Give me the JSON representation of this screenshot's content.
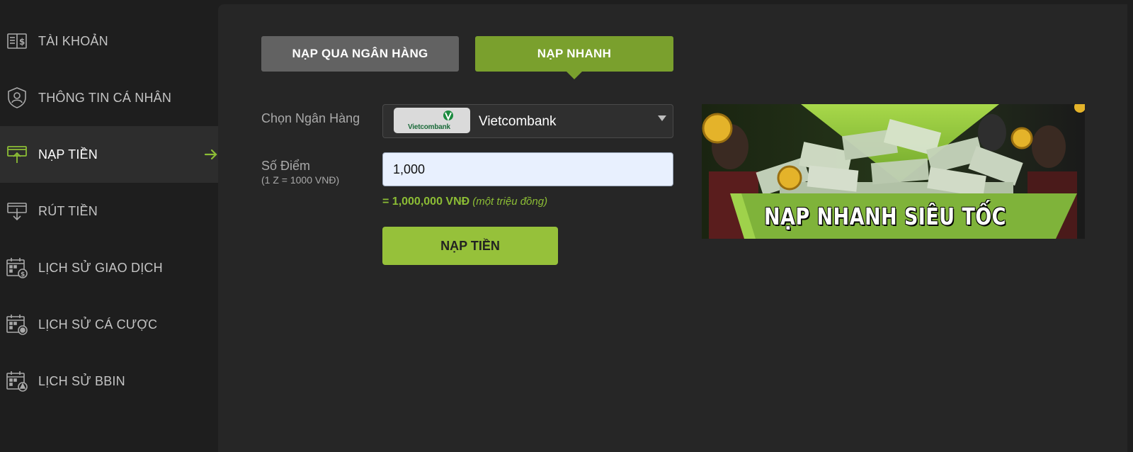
{
  "sidebar": {
    "items": [
      {
        "label": "TÀI KHOẢN",
        "icon": "account-book-icon",
        "active": false
      },
      {
        "label": "THÔNG TIN CÁ NHÂN",
        "icon": "user-shield-icon",
        "active": false
      },
      {
        "label": "NẠP TIỀN",
        "icon": "deposit-icon",
        "active": true
      },
      {
        "label": "RÚT TIỀN",
        "icon": "withdraw-icon",
        "active": false
      },
      {
        "label": "LỊCH SỬ GIAO DỊCH",
        "icon": "calendar-money-icon",
        "active": false
      },
      {
        "label": "LỊCH SỬ CÁ CƯỢC",
        "icon": "calendar-bet-icon",
        "active": false
      },
      {
        "label": "LỊCH SỬ BBIN",
        "icon": "calendar-bbin-icon",
        "active": false
      }
    ],
    "active_arrow_icon": "arrow-right-icon"
  },
  "tabs": {
    "bank_label": "NẠP QUA NGÂN HÀNG",
    "fast_label": "NẠP NHANH",
    "active": "fast"
  },
  "form": {
    "bank_label": "Chọn Ngân Hàng",
    "bank_logo_text": "Vietcombank",
    "bank_selected": "Vietcombank",
    "points_label": "Số Điểm",
    "points_sublabel": "(1 Z = 1000 VNĐ)",
    "points_value": "1,000",
    "conversion_amount": "= 1,000,000 VNĐ",
    "conversion_words": "(một triệu đồng)",
    "submit_label": "NẠP TIỀN"
  },
  "banner": {
    "headline": "NẠP NHANH SIÊU TỐC"
  },
  "colors": {
    "accent_green": "#96c13a",
    "tab_active": "#7aa02d",
    "tab_inactive": "#626262",
    "sidebar_bg": "#1e1e1e",
    "panel_bg": "#262626"
  }
}
